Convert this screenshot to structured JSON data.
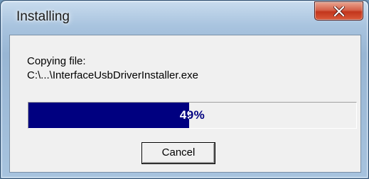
{
  "window": {
    "title": "Installing",
    "close_icon": "close-icon"
  },
  "content": {
    "status_label": "Copying file:",
    "file_path": "C:\\...\\InterfaceUsbDriverInstaller.exe"
  },
  "progress": {
    "percent": 49,
    "label": "49%",
    "fill_color": "#000080"
  },
  "buttons": {
    "cancel_label": "Cancel"
  }
}
